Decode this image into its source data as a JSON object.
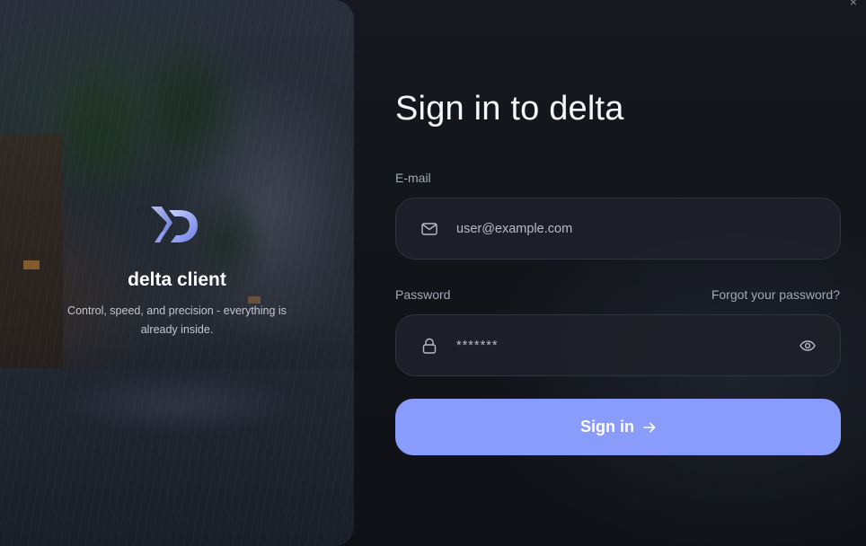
{
  "brand": {
    "name": "delta client",
    "tagline": "Control, speed, and precision - everything is already inside."
  },
  "window": {
    "close_glyph": "×"
  },
  "form": {
    "title": "Sign in to delta",
    "email": {
      "label": "E-mail",
      "placeholder": "user@example.com",
      "icon": "mail-icon"
    },
    "password": {
      "label": "Password",
      "value": "*******",
      "icon": "lock-icon",
      "toggle_icon": "eye-icon"
    },
    "forgot_link": "Forgot your password?",
    "submit": {
      "label": "Sign in",
      "icon": "arrow-right-icon"
    }
  },
  "colors": {
    "accent": "#8a9cfb",
    "background": "#12141a",
    "field_bg": "#1e2129"
  }
}
